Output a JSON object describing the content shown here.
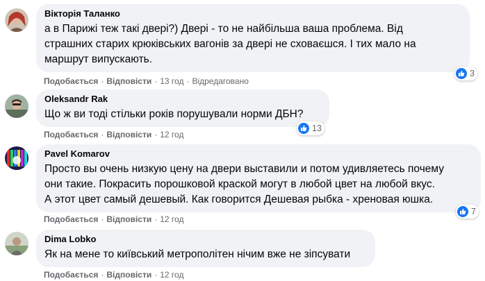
{
  "comments": [
    {
      "author": "Вікторія Таланко",
      "lines": [
        "а в Парижі теж такі двері?) Двері - то не найбільша ваша проблема. Від",
        "страшних старих крюківських вагонів за двері не сховаєшся. І тих мало на",
        "маршрут випускають."
      ],
      "like_label": "Подобається",
      "reply_label": "Відповісти",
      "time": "13 год",
      "edited": "Відредаговано",
      "reaction_count": "3"
    },
    {
      "author": "Oleksandr Rak",
      "lines": [
        "Що ж ви тоді стільки років порушували норми ДБН?"
      ],
      "like_label": "Подобається",
      "reply_label": "Відповісти",
      "time": "12 год",
      "reaction_count": "13"
    },
    {
      "author": "Pavel Komarov",
      "lines": [
        "Просто вы очень низкую цену на двери выставили и потом удивляетесь почему",
        "они такие. Покрасить порошковой краской могут в любой цвет на любой вкус.",
        "А этот цвет самый дешевый. Как говорится Дешевая рыбка - хреновая юшка."
      ],
      "like_label": "Подобається",
      "reply_label": "Відповісти",
      "time": "12 год",
      "reaction_count": "7"
    },
    {
      "author": "Dima Lobko",
      "lines": [
        "Як на мене то київський метрополітен нічим вже не зіпсувати"
      ],
      "like_label": "Подобається",
      "reply_label": "Відповісти",
      "time": "12 год"
    }
  ],
  "colors": {
    "bubble": "#f0f2f5",
    "secondary_text": "#65676b",
    "like_blue": "#1877f2"
  },
  "icons": {
    "reaction": "thumbs-up-icon"
  }
}
